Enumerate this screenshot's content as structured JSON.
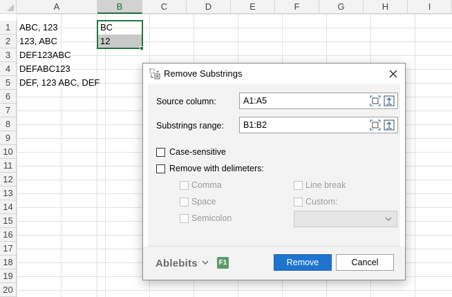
{
  "spreadsheet": {
    "columns": [
      "A",
      "B",
      "C",
      "D",
      "E",
      "F",
      "G",
      "H",
      "I"
    ],
    "rows": [
      "1",
      "2",
      "3",
      "4",
      "5",
      "6",
      "7",
      "8",
      "9",
      "10",
      "11",
      "12",
      "13",
      "14",
      "15",
      "16",
      "17",
      "18",
      "19",
      "20"
    ],
    "cells": {
      "A1": "ABC, 123",
      "A2": "123, ABC",
      "A3": "DEF123ABC",
      "A4": "DEFABC123",
      "A5": "DEF, 123 ABC, DEF",
      "B1": "BC",
      "B2": "12"
    },
    "selected_column": "B",
    "accent_color": "#217346"
  },
  "dialog": {
    "title": "Remove Substrings",
    "title_icon": "remove-substrings-icon",
    "source_column": {
      "label": "Source column:",
      "value": "A1:A5"
    },
    "substrings_range": {
      "label": "Substrings range:",
      "value": "B1:B2"
    },
    "case_sensitive": {
      "label": "Case-sensitive",
      "checked": false
    },
    "remove_with_delimiters": {
      "label": "Remove with delimeters:",
      "checked": false
    },
    "delimiters": {
      "comma": {
        "label": "Comma",
        "checked": false,
        "enabled": false
      },
      "space": {
        "label": "Space",
        "checked": false,
        "enabled": false
      },
      "semicolon": {
        "label": "Semicolon",
        "checked": false,
        "enabled": false
      },
      "line_break": {
        "label": "Line break",
        "checked": false,
        "enabled": false
      },
      "custom": {
        "label": "Custom:",
        "checked": false,
        "enabled": false,
        "value": ""
      }
    },
    "footer": {
      "brand": "Ablebits",
      "help_badge": "F1",
      "remove_label": "Remove",
      "cancel_label": "Cancel"
    },
    "colors": {
      "primary": "#1f74cf",
      "help_badge": "#5c9a6b"
    }
  }
}
